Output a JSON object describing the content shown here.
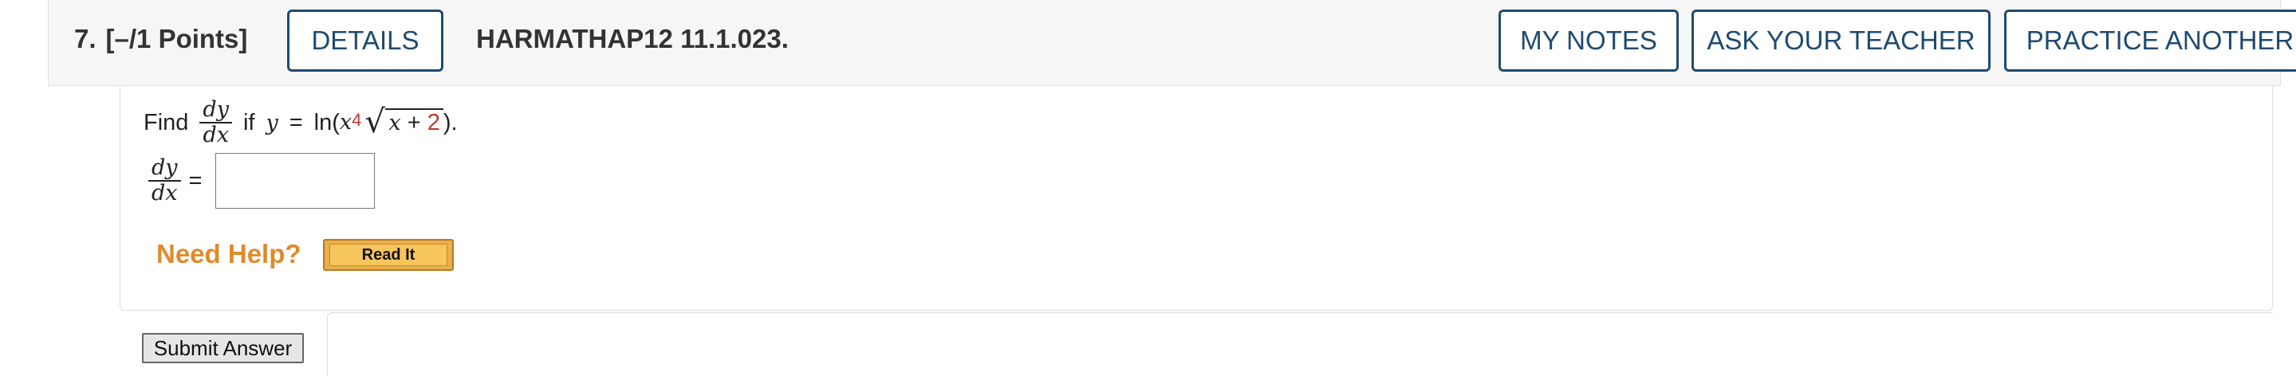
{
  "header": {
    "question_number": "7.",
    "points": "[–/1 Points]",
    "details_label": "DETAILS",
    "question_code": "HARMATHAP12 11.1.023.",
    "my_notes_label": "MY NOTES",
    "ask_teacher_label": "ASK YOUR TEACHER",
    "practice_label": "PRACTICE ANOTHER"
  },
  "question": {
    "find_label": "Find",
    "dy": "dy",
    "dx": "dx",
    "if_label": "if",
    "y": "y",
    "equals": "=",
    "ln": "ln(",
    "x": "x",
    "exponent": "4",
    "sqrt_x": "x",
    "plus": "+",
    "two": "2",
    "close": ").",
    "answer_dy": "dy",
    "answer_dx": "dx",
    "answer_equals": "=",
    "answer_value": ""
  },
  "help": {
    "need_help_label": "Need Help?",
    "read_it_label": "Read It"
  },
  "submit_label": "Submit Answer",
  "colors": {
    "accent_blue": "#1f4a70",
    "help_orange": "#e08a2c",
    "highlight_red": "#c0392b"
  }
}
